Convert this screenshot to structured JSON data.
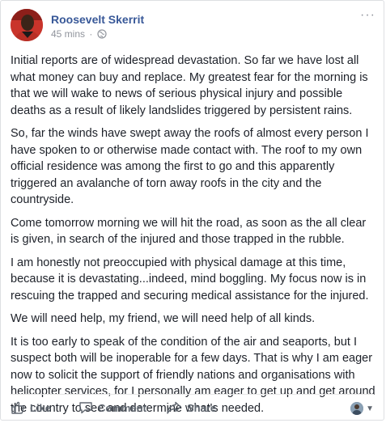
{
  "post": {
    "author": "Roosevelt Skerrit",
    "timestamp": "45 mins",
    "separator": "·",
    "more_label": "···",
    "paragraphs": [
      "Initial reports are of widespread devastation. So far we have lost all what money can buy and replace. My greatest fear for the morning is that we will wake to news of serious physical injury and possible deaths as a result of likely landslides triggered by persistent rains.",
      "So, far the winds have swept away the roofs of almost every person I have spoken to or otherwise made contact with. The roof to my own official residence was among the first to go and this apparently triggered an avalanche of torn away roofs in the city and the countryside.",
      "Come tomorrow morning we will hit the road, as soon as the all clear is given, in search of the injured and those trapped in the rubble.",
      "I am honestly not preoccupied with physical damage at this time, because it is devastating...indeed, mind boggling. My focus now is in rescuing the trapped and securing medical assistance for the injured.",
      "We will need help, my friend, we will need help of all kinds.",
      "It is too early to speak of the condition of the air and seaports, but I suspect both will be inoperable for a few days. That is why I am eager now to solicit the support of friendly nations and organisations with helicopter services, for I personally am eager to get up and get around the country to see and determine what's needed."
    ]
  },
  "actions": {
    "like_label": "Like",
    "comment_label": "Comment",
    "share_label": "Share"
  },
  "icons": {
    "avatar": "profile-photo",
    "privacy": "globe-icon",
    "like": "thumbs-up-icon",
    "comment": "speech-bubble-icon",
    "share": "share-arrow-icon",
    "audience": "audience-selector"
  },
  "colors": {
    "author": "#385898",
    "meta": "#90949c",
    "text": "#1d2129",
    "action": "#606770"
  }
}
